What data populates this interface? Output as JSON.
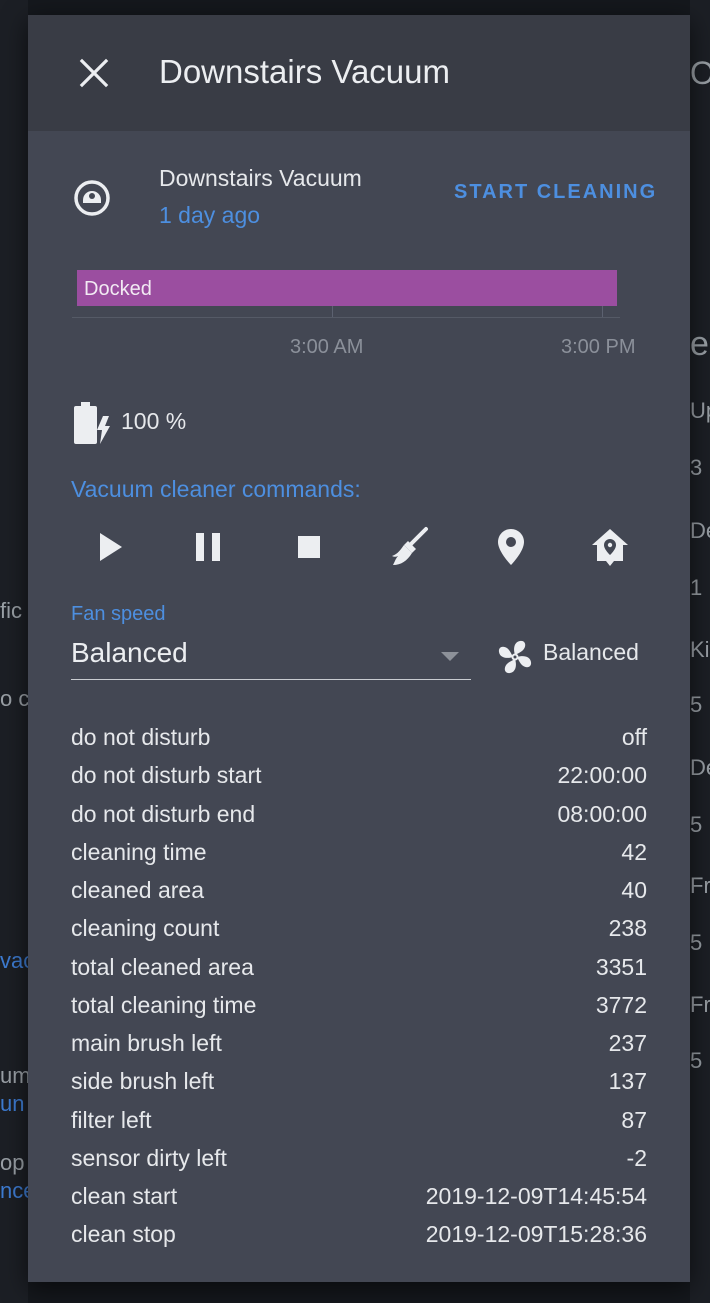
{
  "dialog": {
    "title": "Downstairs Vacuum",
    "close_icon": "close-icon"
  },
  "entity": {
    "name": "Downstairs Vacuum",
    "last_changed": "1 day ago",
    "icon": "robot-vacuum-icon",
    "start_button": "START CLEANING"
  },
  "timeline": {
    "state_label": "Docked",
    "bar_color": "#9b4ea0",
    "ticks": [
      "3:00 AM",
      "3:00 PM"
    ]
  },
  "battery": {
    "icon": "battery-charging-icon",
    "text": "100 %"
  },
  "commands": {
    "label": "Vacuum cleaner commands:",
    "items": [
      {
        "name": "play-icon"
      },
      {
        "name": "pause-icon"
      },
      {
        "name": "stop-icon"
      },
      {
        "name": "broom-icon"
      },
      {
        "name": "map-marker-icon"
      },
      {
        "name": "home-map-marker-icon"
      }
    ]
  },
  "fan_speed": {
    "label": "Fan speed",
    "selected": "Balanced",
    "current": "Balanced",
    "icon": "fan-icon"
  },
  "attributes": [
    {
      "name": "do not disturb",
      "value": "off"
    },
    {
      "name": "do not disturb start",
      "value": "22:00:00"
    },
    {
      "name": "do not disturb end",
      "value": "08:00:00"
    },
    {
      "name": "cleaning time",
      "value": "42"
    },
    {
      "name": "cleaned area",
      "value": "40"
    },
    {
      "name": "cleaning count",
      "value": "238"
    },
    {
      "name": "total cleaned area",
      "value": "3351"
    },
    {
      "name": "total cleaning time",
      "value": "3772"
    },
    {
      "name": "main brush left",
      "value": "237"
    },
    {
      "name": "side brush left",
      "value": "137"
    },
    {
      "name": "filter left",
      "value": "87"
    },
    {
      "name": "sensor dirty left",
      "value": "-2"
    },
    {
      "name": "clean start",
      "value": "2019-12-09T14:45:54"
    },
    {
      "name": "clean stop",
      "value": "2019-12-09T15:28:36"
    }
  ],
  "background": {
    "left_fragments": [
      "fic",
      "o c",
      "vac",
      "um",
      "un",
      "op",
      "nce"
    ],
    "right_fragments": [
      "O",
      "e",
      "Up",
      "3",
      "De",
      "1",
      "Ki",
      "5",
      "De",
      "5",
      "Fr",
      "5",
      "Fr",
      "5"
    ]
  }
}
